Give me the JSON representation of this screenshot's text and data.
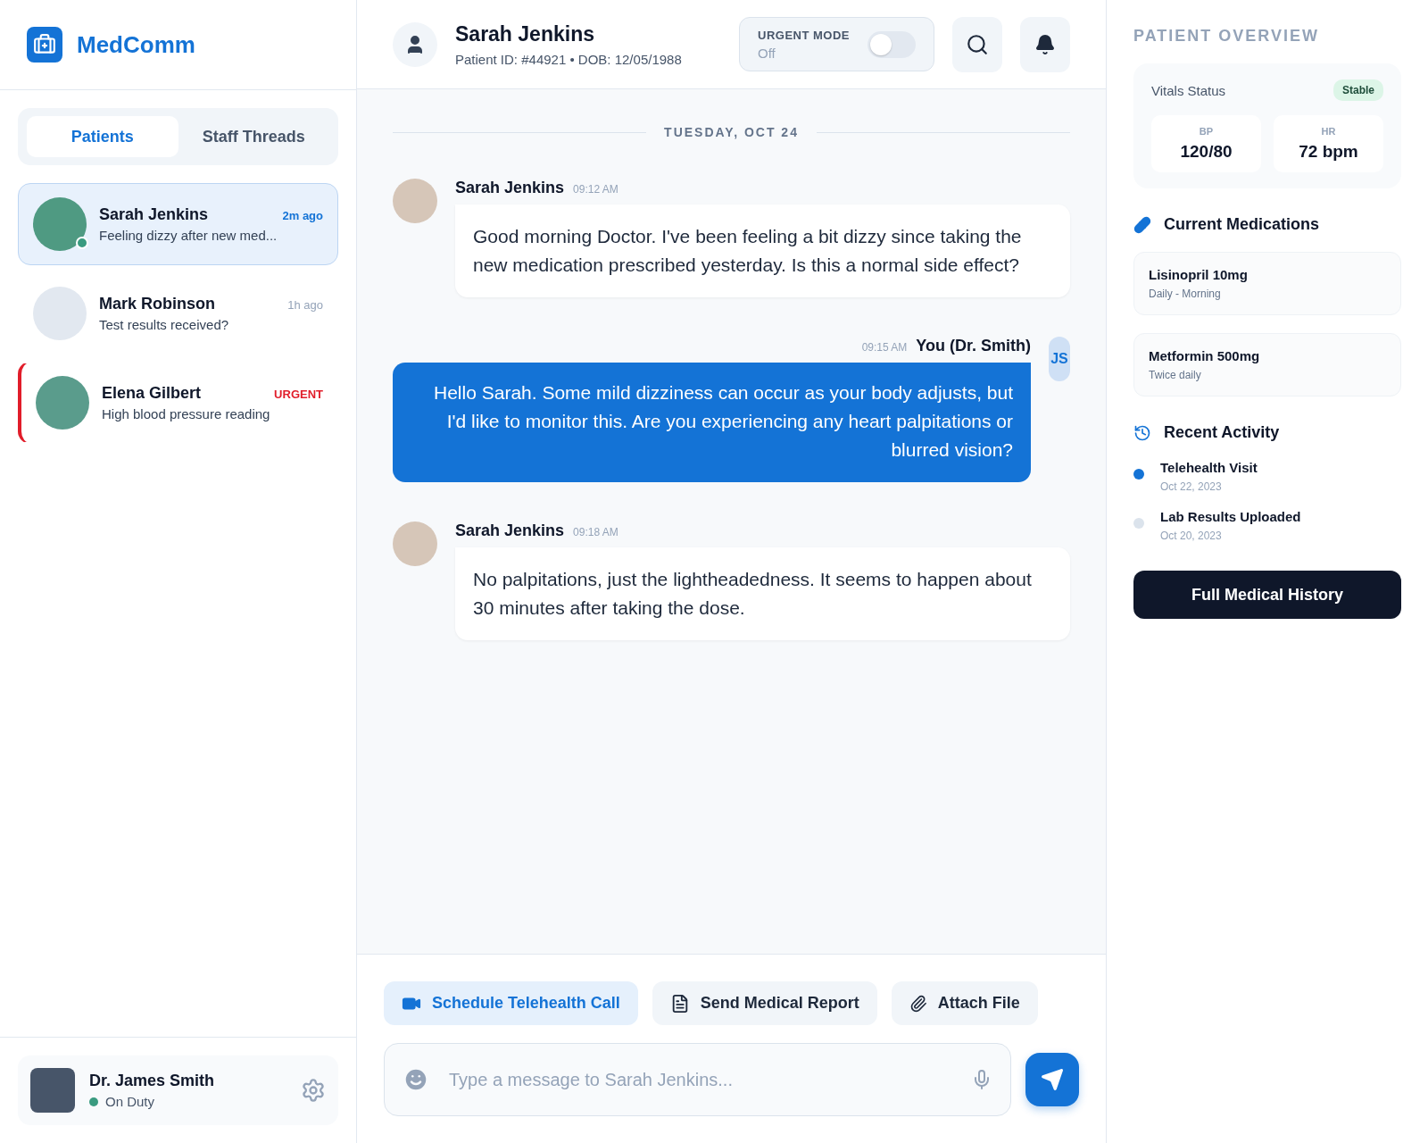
{
  "brand": {
    "name": "MedComm"
  },
  "tabs": [
    {
      "label": "Patients",
      "selected": true
    },
    {
      "label": "Staff Threads",
      "selected": false
    }
  ],
  "conversations": [
    {
      "name": "Sarah Jenkins",
      "preview": "Feeling dizzy after new med...",
      "time": "2m ago",
      "selected": true,
      "online": true,
      "urgent": false
    },
    {
      "name": "Mark Robinson",
      "preview": "Test results received?",
      "time": "1h ago",
      "selected": false,
      "online": false,
      "urgent": false
    },
    {
      "name": "Elena Gilbert",
      "preview": "High blood pressure reading",
      "time": "URGENT",
      "selected": false,
      "online": false,
      "urgent": true
    }
  ],
  "user": {
    "name": "Dr. James Smith",
    "status": "On Duty"
  },
  "header": {
    "name": "Sarah Jenkins",
    "meta": "Patient ID: #44921 • DOB: 12/05/1988",
    "urgent_mode": {
      "label": "URGENT MODE",
      "value": "Off",
      "on": false
    }
  },
  "date_divider": "TUESDAY, OCT 24",
  "messages": [
    {
      "sender": "Sarah Jenkins",
      "time": "09:12 AM",
      "outgoing": false,
      "text": "Good morning Doctor. I've been feeling a bit dizzy since taking the new medication prescribed yesterday. Is this a normal side effect?"
    },
    {
      "sender": "You (Dr. Smith)",
      "time": "09:15 AM",
      "outgoing": true,
      "initials": "JS",
      "text": "Hello Sarah. Some mild dizziness can occur as your body adjusts, but I'd like to monitor this. Are you experiencing any heart palpitations or blurred vision?"
    },
    {
      "sender": "Sarah Jenkins",
      "time": "09:18 AM",
      "outgoing": false,
      "text": "No palpitations, just the lightheadedness. It seems to happen about 30 minutes after taking the dose."
    }
  ],
  "actions": [
    {
      "label": "Schedule Telehealth Call",
      "kind": "video",
      "primary": true
    },
    {
      "label": "Send Medical Report",
      "kind": "document",
      "primary": false
    },
    {
      "label": "Attach File",
      "kind": "attach",
      "primary": false
    }
  ],
  "composer": {
    "placeholder": "Type a message to Sarah Jenkins..."
  },
  "overview": {
    "title": "PATIENT OVERVIEW",
    "vitals": {
      "label": "Vitals Status",
      "status": "Stable",
      "readings": [
        {
          "label": "BP",
          "value": "120/80"
        },
        {
          "label": "HR",
          "value": "72 bpm"
        }
      ]
    },
    "medications": {
      "title": "Current Medications",
      "items": [
        {
          "name": "Lisinopril 10mg",
          "schedule": "Daily - Morning"
        },
        {
          "name": "Metformin 500mg",
          "schedule": "Twice daily"
        }
      ]
    },
    "activity": {
      "title": "Recent Activity",
      "items": [
        {
          "title": "Telehealth Visit",
          "date": "Oct 22, 2023",
          "current": true
        },
        {
          "title": "Lab Results Uploaded",
          "date": "Oct 20, 2023",
          "current": false
        }
      ]
    },
    "button": "Full Medical History"
  }
}
